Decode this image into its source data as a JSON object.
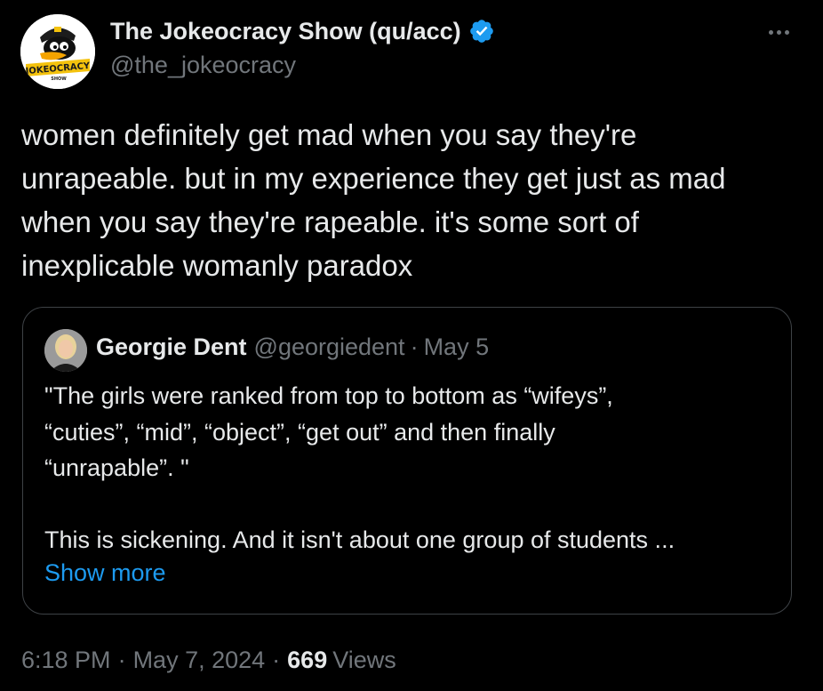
{
  "author": {
    "name": "The Jokeocracy Show (qu/acc)",
    "handle": "@the_jokeocracy",
    "verified": true,
    "avatar_logo_text": "JOKEOCRACY",
    "avatar_logo_small_text": "SHOW"
  },
  "tweet": {
    "text": "women definitely get mad when you say they're\nunrapeable. but in my experience they get just as mad\nwhen you say they're rapeable. it's some sort of\ninexplicable womanly paradox"
  },
  "quote": {
    "name": "Georgie Dent",
    "handle": "@georgiedent",
    "separator": "·",
    "date": "May 5",
    "text": "\"The girls were ranked from top to bottom as “wifeys”,\n“cuties”, “mid”, “object”, “get out” and then finally\n“unrapable”. \"\n\nThis is sickening. And it isn't about one group of students ...",
    "show_more": "Show more"
  },
  "meta": {
    "time": "6:18 PM",
    "separator": "·",
    "date": "May 7, 2024",
    "views_count": "669",
    "views_label": "Views"
  },
  "colors": {
    "background": "#000000",
    "text_primary": "#e7e9ea",
    "text_secondary": "#71767b",
    "accent_link": "#1d9bf0",
    "verified_badge": "#1d9bf0",
    "card_border": "#3e4246"
  },
  "icons": {
    "verified": "verified-badge-icon",
    "more": "more-horizontal-icon"
  }
}
